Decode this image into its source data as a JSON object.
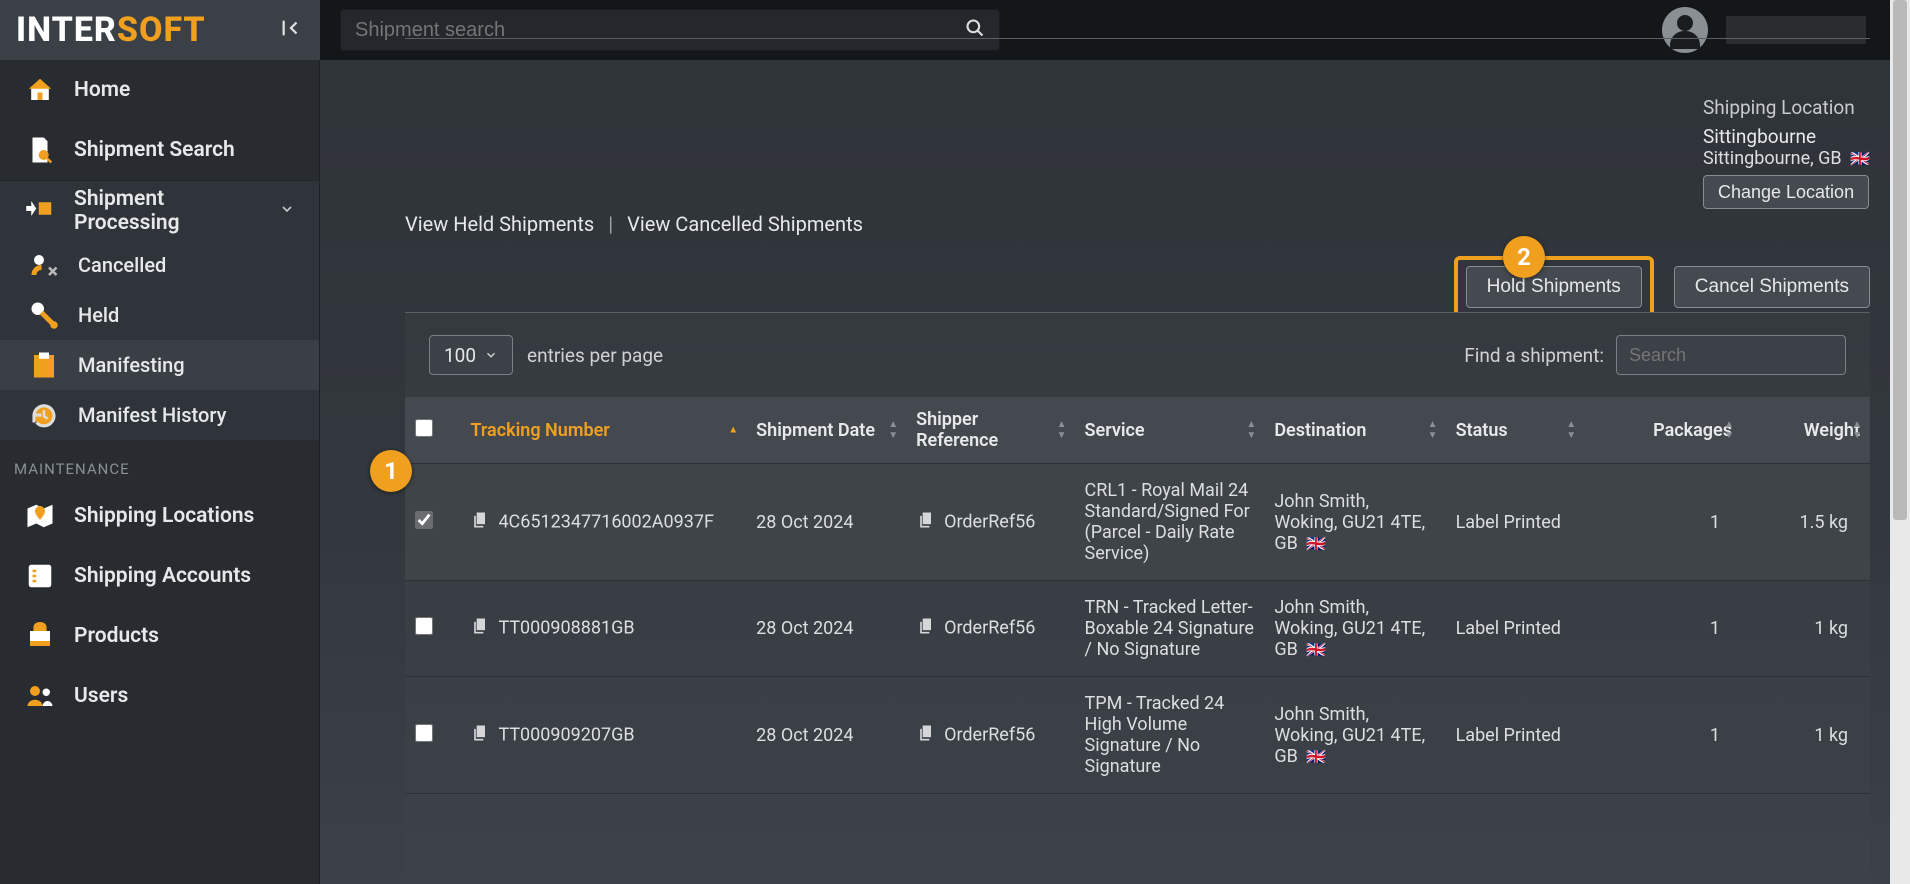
{
  "brand": {
    "part1": "INTER",
    "part2": "SOFT"
  },
  "search_placeholder": "Shipment search",
  "sidebar": {
    "home": "Home",
    "shipment_search": "Shipment Search",
    "shipment_processing": "Shipment Processing",
    "cancelled": "Cancelled",
    "held": "Held",
    "manifesting": "Manifesting",
    "manifest_history": "Manifest History",
    "maintenance_label": "MAINTENANCE",
    "shipping_locations": "Shipping Locations",
    "shipping_accounts": "Shipping Accounts",
    "products": "Products",
    "users": "Users"
  },
  "location": {
    "label": "Shipping Location",
    "name": "Sittingbourne",
    "addr": "Sittingbourne, GB",
    "flag": "🇬🇧",
    "change_btn": "Change Location"
  },
  "links": {
    "held": "View Held Shipments",
    "sep": "|",
    "cancelled": "View Cancelled Shipments"
  },
  "actions": {
    "hold": "Hold Shipments",
    "cancel": "Cancel Shipments"
  },
  "table": {
    "per_page_value": "100",
    "entries_label": "entries per page",
    "find_label": "Find a shipment:",
    "find_placeholder": "Search",
    "headers": {
      "tracking": "Tracking Number",
      "date": "Shipment Date",
      "ref": "Shipper Reference",
      "service": "Service",
      "dest": "Destination",
      "status": "Status",
      "packages": "Packages",
      "weight": "Weight"
    },
    "rows": [
      {
        "checked": true,
        "tracking": "4C6512347716002A0937F",
        "date": "28 Oct 2024",
        "ref": "OrderRef56",
        "service": "CRL1 - Royal Mail 24 Standard/Signed For (Parcel - Daily Rate Service)",
        "dest": "John Smith, Woking, GU21 4TE, GB",
        "flag": "🇬🇧",
        "status": "Label Printed",
        "packages": "1",
        "weight": "1.5 kg"
      },
      {
        "checked": false,
        "tracking": "TT000908881GB",
        "date": "28 Oct 2024",
        "ref": "OrderRef56",
        "service": "TRN - Tracked Letter-Boxable 24 Signature / No Signature",
        "dest": "John Smith, Woking, GU21 4TE, GB",
        "flag": "🇬🇧",
        "status": "Label Printed",
        "packages": "1",
        "weight": "1 kg"
      },
      {
        "checked": false,
        "tracking": "TT000909207GB",
        "date": "28 Oct 2024",
        "ref": "OrderRef56",
        "service": "TPM - Tracked 24 High Volume Signature / No Signature",
        "dest": "John Smith, Woking, GU21 4TE, GB",
        "flag": "🇬🇧",
        "status": "Label Printed",
        "packages": "1",
        "weight": "1 kg"
      }
    ]
  },
  "callouts": {
    "c1": "1",
    "c2": "2"
  }
}
